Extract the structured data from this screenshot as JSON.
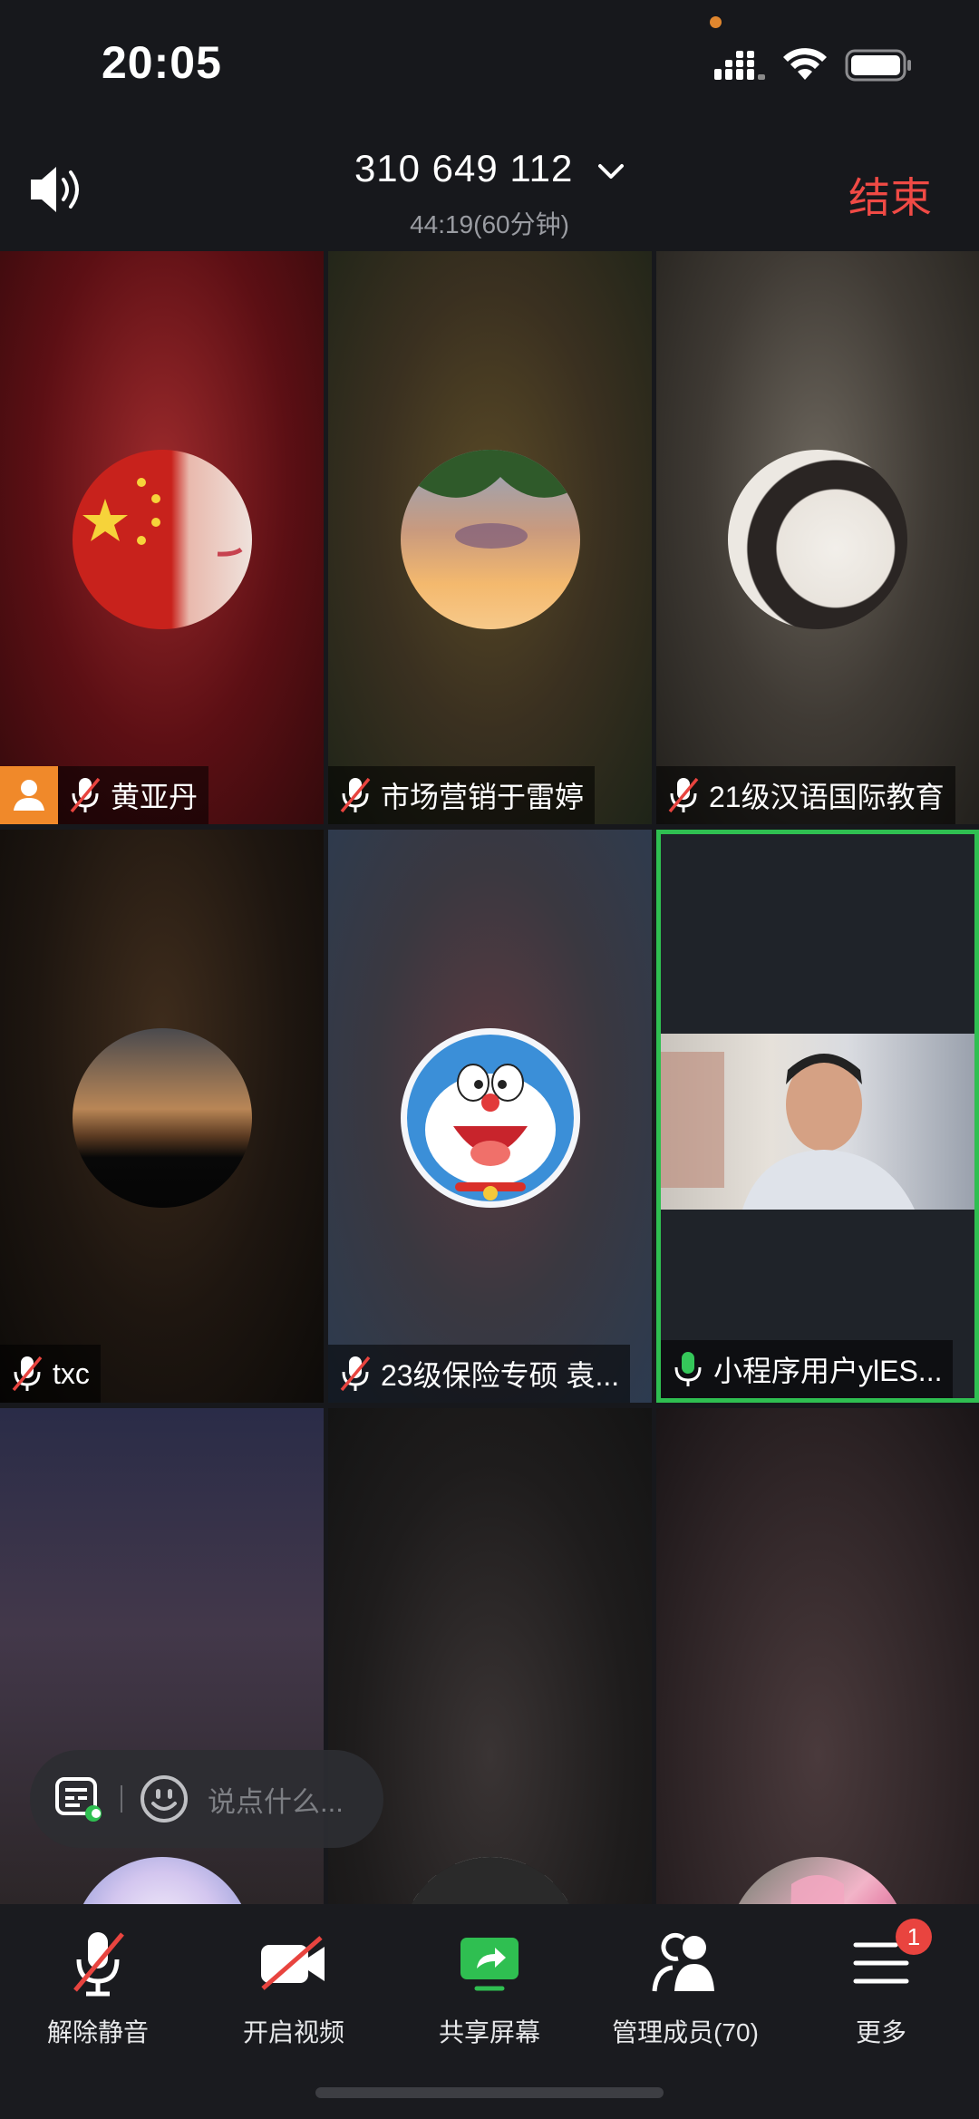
{
  "status_bar": {
    "time": "20:05",
    "icons": [
      "recording-dot-icon",
      "signal-icon",
      "wifi-icon",
      "battery-icon"
    ]
  },
  "meeting": {
    "id": "310 649 112",
    "duration": "44:19(60分钟)",
    "end_label": "结束"
  },
  "tiles": [
    {
      "name": "黄亚丹",
      "muted": true,
      "host": true
    },
    {
      "name": "市场营销于雷婷",
      "muted": true
    },
    {
      "name": "21级汉语国际教育",
      "muted": true
    },
    {
      "name": "txc",
      "muted": true
    },
    {
      "name": "23级保险专硕 袁...",
      "muted": true
    },
    {
      "name": "小程序用户ylES...",
      "muted": false,
      "video_on": true,
      "active_speaker": true
    },
    {
      "name": "",
      "muted": true
    },
    {
      "name": "",
      "muted": true
    },
    {
      "name": "",
      "muted": true
    }
  ],
  "chat": {
    "placeholder": "说点什么..."
  },
  "toolbar": {
    "unmute": "解除静音",
    "video": "开启视频",
    "share": "共享屏幕",
    "members": "管理成员(70)",
    "more": "更多",
    "more_badge": "1"
  },
  "colors": {
    "accent_green": "#2fbf51",
    "end_red": "#f04a45",
    "host_orange": "#f0892a"
  }
}
